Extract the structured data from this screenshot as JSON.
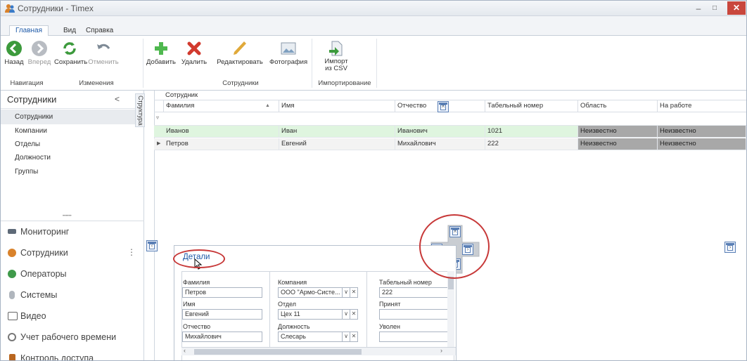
{
  "window": {
    "title": "Сотрудники - Timex",
    "minimize": "–",
    "maximize": "□",
    "close": "✕"
  },
  "tabs": [
    {
      "label": "Главная"
    },
    {
      "label": "Вид"
    },
    {
      "label": "Справка"
    }
  ],
  "ribbon": {
    "buttons": {
      "back": "Назад",
      "forward": "Вперед",
      "save": "Сохранить",
      "cancel": "Отменить",
      "add": "Добавить",
      "delete": "Удалить",
      "edit": "Редактировать",
      "photo": "Фотография",
      "import_line1": "Импорт",
      "import_line2": "из CSV"
    },
    "groups": {
      "nav": "Навигация",
      "changes": "Изменения",
      "employees": "Сотрудники",
      "import": "Импортирование"
    }
  },
  "left_panel": {
    "title": "Сотрудники",
    "collapse": "<",
    "structure_tab": "Структура",
    "items": [
      "Сотрудники",
      "Компании",
      "Отделы",
      "Должности",
      "Группы"
    ],
    "splitter": "••••••",
    "modules": [
      "Мониторинг",
      "Сотрудники",
      "Операторы",
      "Системы",
      "Видео",
      "Учет рабочего времени",
      "Контроль доступа"
    ],
    "more": "⋮"
  },
  "colors": {
    "accent": "#1e5aa8",
    "highlight_row": "#dff5df",
    "unknown_cell": "#a8a8a8",
    "annotation": "#c73838"
  },
  "grid": {
    "band": "Сотрудник",
    "columns": [
      "Фамилия",
      "Имя",
      "Отчество",
      "Табельный номер",
      "Область",
      "На работе"
    ],
    "sort_marker": "▲",
    "rows": [
      [
        "Иванов",
        "Иван",
        "Иванович",
        "1021",
        "Неизвестно",
        "Неизвестно"
      ],
      [
        "Петров",
        "Евгений",
        "Михайлович",
        "222",
        "Неизвестно",
        "Неизвестно"
      ]
    ]
  },
  "details": {
    "title": "Детали",
    "col1": {
      "l1": "Фамилия",
      "v1": "Петров",
      "l2": "Имя",
      "v2": "Евгений",
      "l3": "Отчество",
      "v3": "Михайлович"
    },
    "col2": {
      "l1": "Компания",
      "v1": "ООО \"Армо-Систе...",
      "l2": "Отдел",
      "v2": "Цех 11",
      "l3": "Должность",
      "v3": "Слесарь"
    },
    "col3": {
      "l1": "Табельный номер",
      "v1": "222",
      "l2": "Принят",
      "v2": "",
      "l3": "Уволен",
      "v3": ""
    }
  }
}
